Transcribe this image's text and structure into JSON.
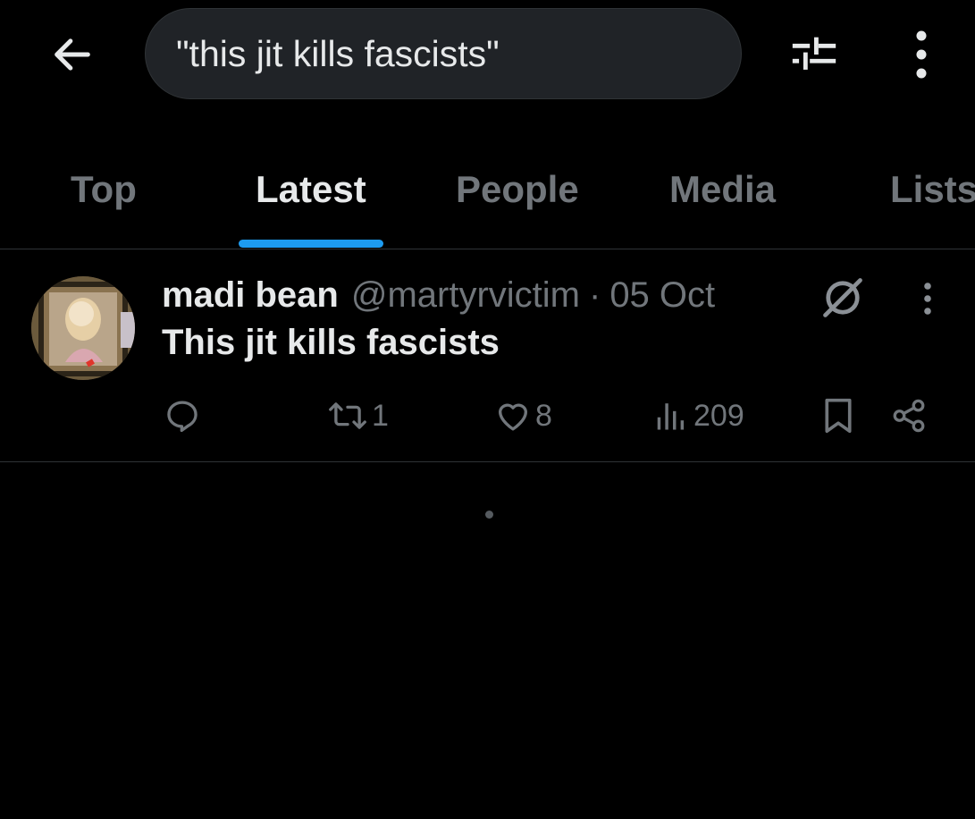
{
  "search": {
    "query": "\"this jit kills fascists\""
  },
  "tabs": [
    {
      "label": "Top",
      "active": false
    },
    {
      "label": "Latest",
      "active": true
    },
    {
      "label": "People",
      "active": false
    },
    {
      "label": "Media",
      "active": false
    },
    {
      "label": "Lists",
      "active": false
    }
  ],
  "tweet": {
    "display_name": "madi bean",
    "handle": "@martyrvictim",
    "separator": "·",
    "timestamp": "05 Oct",
    "text": "This jit kills fascists",
    "retweets": "1",
    "likes": "8",
    "views": "209"
  },
  "icons": {
    "back": "arrow-left-icon",
    "filter": "sliders-icon",
    "more": "vertical-dots-icon",
    "grok": "grok-icon",
    "reply": "reply-icon",
    "retweet": "retweet-icon",
    "like": "heart-icon",
    "views": "bar-chart-icon",
    "bookmark": "bookmark-icon",
    "share": "share-icon"
  },
  "colors": {
    "background": "#000000",
    "accent": "#1d9bf0",
    "text_primary": "#e7e9ea",
    "text_secondary": "#71767b",
    "search_bg": "#202327"
  }
}
